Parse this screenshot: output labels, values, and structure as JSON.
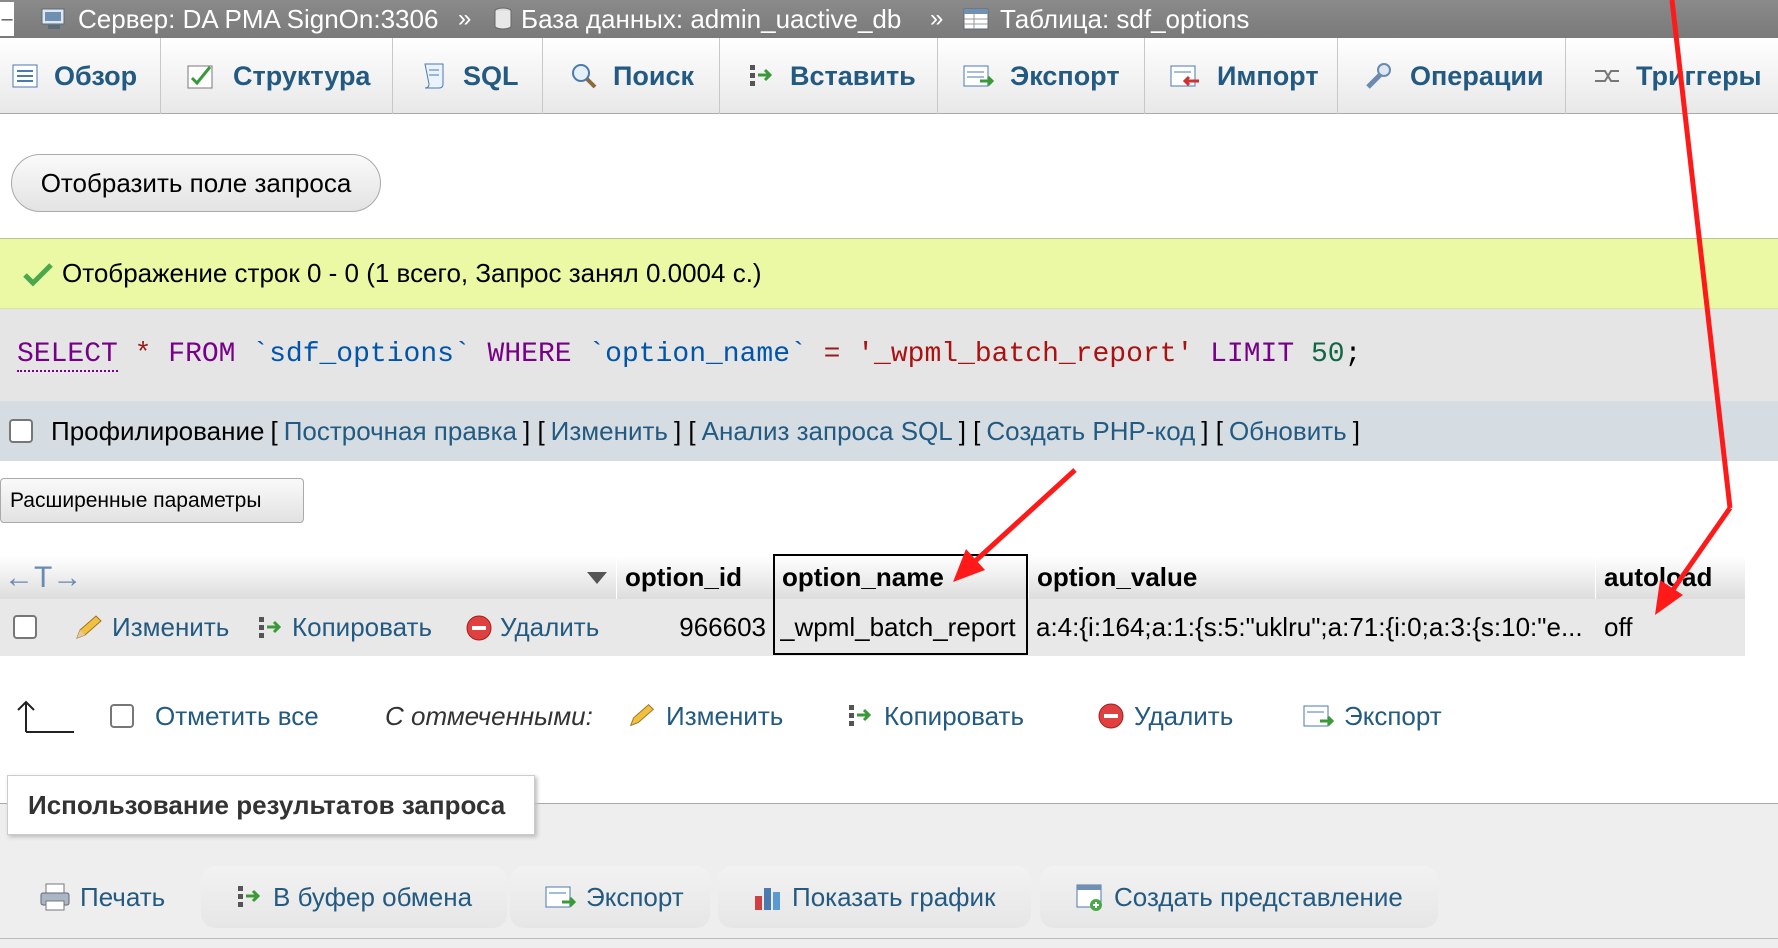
{
  "breadcrumb": {
    "server": "Сервер: DA PMA SignOn:3306",
    "sep1": "»",
    "database": "База данных: admin_uactive_db",
    "sep2": "»",
    "table": "Таблица: sdf_options"
  },
  "tabs": [
    {
      "label": "Обзор",
      "icon": "browse-icon"
    },
    {
      "label": "Структура",
      "icon": "structure-icon"
    },
    {
      "label": "SQL",
      "icon": "sql-icon"
    },
    {
      "label": "Поиск",
      "icon": "search-icon"
    },
    {
      "label": "Вставить",
      "icon": "insert-icon"
    },
    {
      "label": "Экспорт",
      "icon": "export-icon"
    },
    {
      "label": "Импорт",
      "icon": "import-icon"
    },
    {
      "label": "Операции",
      "icon": "wrench-icon"
    },
    {
      "label": "Триггеры",
      "icon": "triggers-icon"
    }
  ],
  "show_query_button": "Отобразить поле запроса",
  "success_message": "Отображение строк 0 - 0 (1 всего, Запрос занял 0.0004 с.)",
  "sql": {
    "select": "SELECT",
    "star": "*",
    "from": "FROM",
    "table": "`sdf_options`",
    "where": "WHERE",
    "column": "`option_name`",
    "eq": "=",
    "value": "'_wpml_batch_report'",
    "limit": "LIMIT",
    "limit_value": "50",
    "semicolon": ";"
  },
  "profiling": {
    "label": "Профилирование",
    "links": [
      "Построчная правка",
      "Изменить",
      "Анализ запроса SQL",
      "Создать PHP-код",
      "Обновить"
    ]
  },
  "advanced_button": "Расширенные параметры",
  "table": {
    "sort_arrows": "←T→",
    "columns": [
      "option_id",
      "option_name",
      "option_value",
      "autoload"
    ],
    "row": {
      "actions": [
        "Изменить",
        "Копировать",
        "Удалить"
      ],
      "option_id": "966603",
      "option_name": "_wpml_batch_report",
      "option_value": "a:4:{i:164;a:1:{s:5:\"uklru\";a:71:{i:0;a:3:{s:10:\"e...",
      "autoload": "off"
    }
  },
  "bulk": {
    "check_all": "Отметить все",
    "with_selected": "С отмеченными:",
    "actions": [
      "Изменить",
      "Копировать",
      "Удалить",
      "Экспорт"
    ]
  },
  "query_results": {
    "legend": "Использование результатов запроса",
    "actions": [
      "Печать",
      "В буфер обмена",
      "Экспорт",
      "Показать график",
      "Создать представление"
    ]
  },
  "colors": {
    "link": "#235a81",
    "success_bg": "#ebf8a4",
    "annotation_arrow": "#ff0000"
  }
}
